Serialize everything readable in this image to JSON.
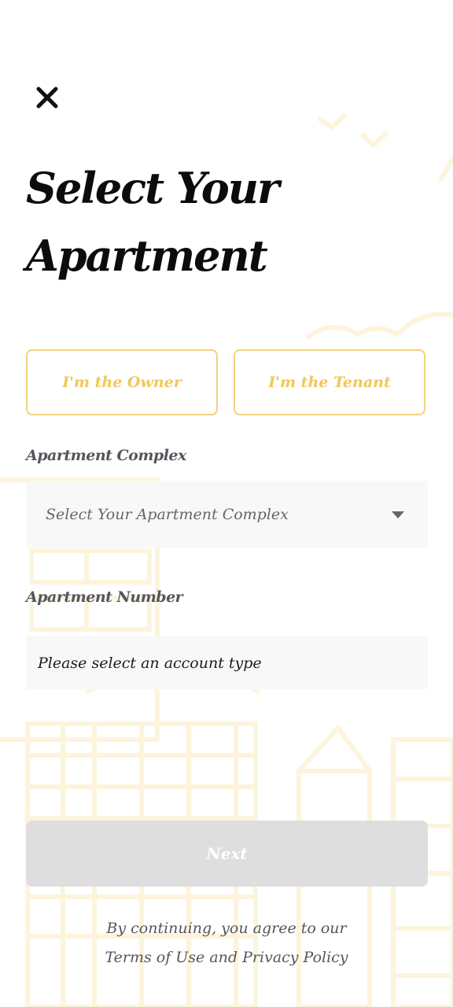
{
  "header": {
    "close_icon": "close-icon",
    "title_line1": "Select Your",
    "title_line2": "Apartment"
  },
  "roles": {
    "owner_label": "I'm the Owner",
    "tenant_label": "I'm the Tenant"
  },
  "complex": {
    "label": "Apartment Complex",
    "placeholder": "Select Your Apartment Complex",
    "dropdown_icon": "caret-down-icon"
  },
  "apartment_number": {
    "label": "Apartment Number",
    "value": "Please select an account type"
  },
  "actions": {
    "next_label": "Next"
  },
  "footer": {
    "line1": "By continuing, you agree to our",
    "terms_link": "Terms of Use",
    "and_text": "and",
    "privacy_link": "Privacy Policy"
  },
  "colors": {
    "accent": "#f1c75a",
    "accent_border": "#f1d27f",
    "disabled_button": "#dedede",
    "field_background": "#f8f8f8",
    "label_text": "#55555d"
  }
}
